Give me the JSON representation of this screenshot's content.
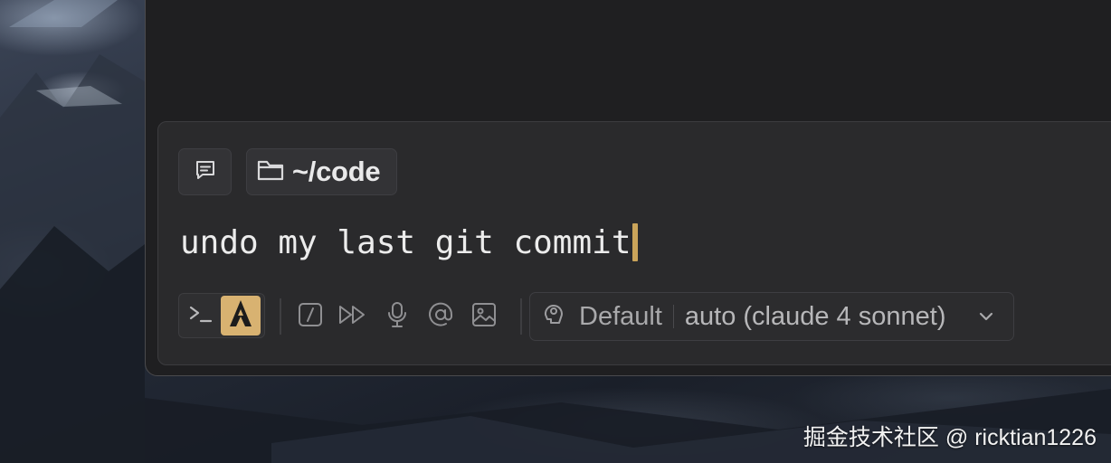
{
  "context": {
    "directory_label": "~/code"
  },
  "prompt": {
    "text": "undo my last git commit"
  },
  "toolbar": {
    "mode_terminal_icon": "terminal-icon",
    "mode_agent_icon": "agent-icon",
    "tools": [
      "slash-command-icon",
      "fast-forward-icon",
      "microphone-icon",
      "at-mention-icon",
      "image-icon"
    ]
  },
  "model_selector": {
    "profile": "Default",
    "model": "auto (claude 4 sonnet)"
  },
  "watermark": "掘金技术社区 @ ricktian1226",
  "colors": {
    "accent": "#d8b271",
    "cursor": "#caa45a",
    "panel": "#2a2a2c",
    "window": "#1f1f21"
  }
}
